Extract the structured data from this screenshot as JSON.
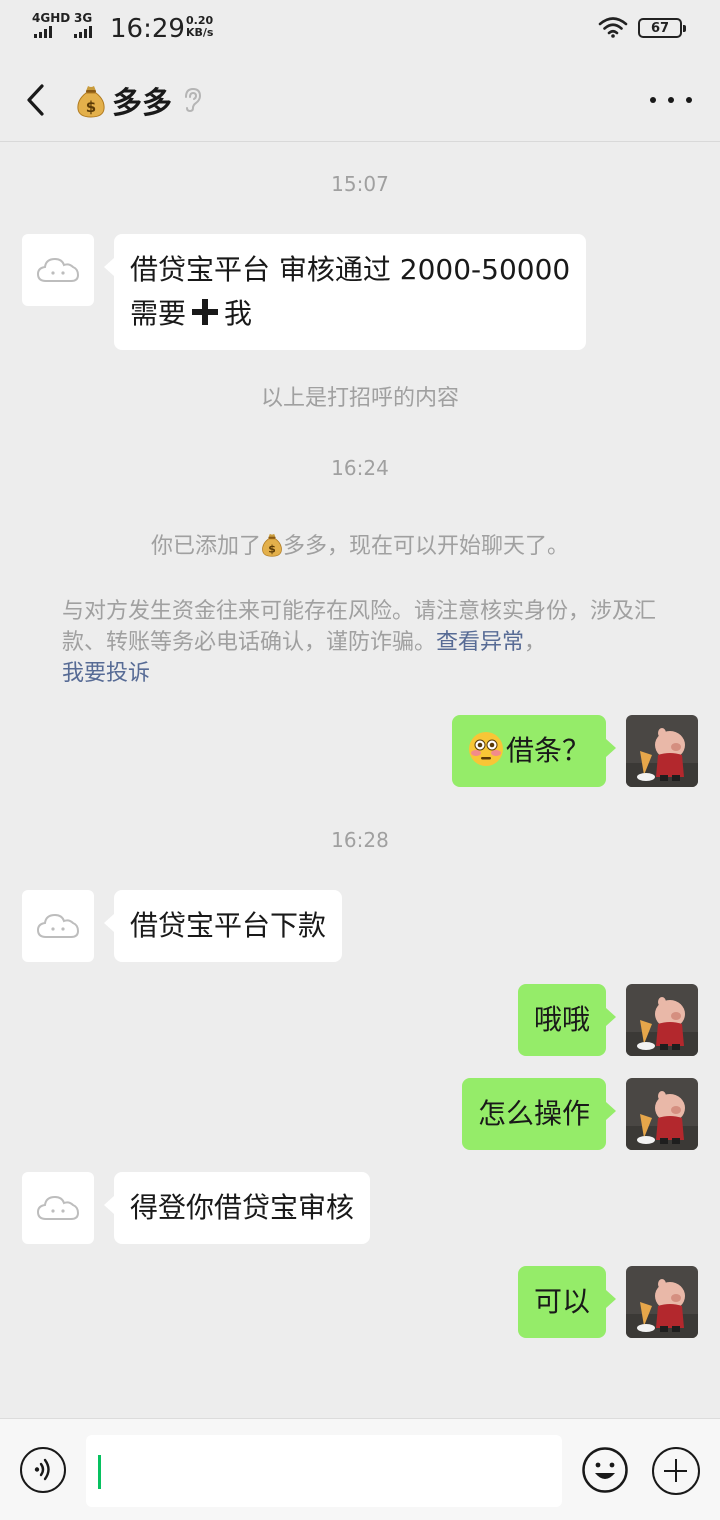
{
  "status_bar": {
    "network1": "4GHD",
    "network2": "3G",
    "time": "16:29",
    "speed_value": "0.20",
    "speed_unit": "KB/s",
    "battery": "67"
  },
  "header": {
    "title": "多多",
    "title_icon": "money-bag-emoji",
    "back_icon": "chevron-left-icon",
    "ear_icon": "ear-icon",
    "more_icon": "more-icon"
  },
  "messages": {
    "time1": "15:07",
    "m1_line1": "借贷宝平台 审核通过 2000-50000",
    "m1_line2a": "需要",
    "m1_line2b": "我",
    "sys1": "以上是打招呼的内容",
    "time2": "16:24",
    "sys2a": "你已添加了",
    "sys2b": "多多，现在可以开始聊天了。",
    "warn_text": "与对方发生资金往来可能存在风险。请注意核实身份，涉及汇款、转账等务必电话确认，谨防诈骗。",
    "warn_link1": "查看异常",
    "warn_sep": "，",
    "warn_link2": "我要投诉",
    "m2": "借条？",
    "time3": "16:28",
    "m3": "借贷宝平台下款",
    "m4": "哦哦",
    "m5": "怎么操作",
    "m6": "得登你借贷宝审核",
    "m7": "可以"
  },
  "colors": {
    "outgoing_bubble": "#95ec69",
    "incoming_bubble": "#ffffff",
    "background": "#ededed",
    "link": "#576b95",
    "cursor": "#07c160"
  }
}
